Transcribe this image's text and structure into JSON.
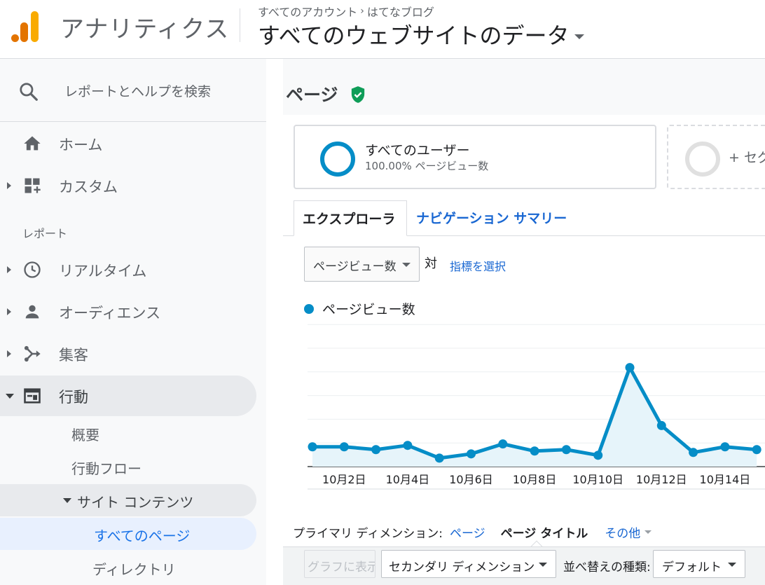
{
  "header": {
    "app_name": "アナリティクス",
    "breadcrumb_account": "すべてのアカウント",
    "breadcrumb_separator": "›",
    "breadcrumb_property": "はてなブログ",
    "view_name": "すべてのウェブサイトのデータ",
    "logo_colors": [
      "#f9ab00",
      "#e37400"
    ]
  },
  "sidebar": {
    "search_placeholder": "レポートとヘルプを検索",
    "home": "ホーム",
    "custom": "カスタム",
    "reports_label": "レポート",
    "items": [
      {
        "label": "リアルタイム",
        "icon": "clock-icon"
      },
      {
        "label": "オーディエンス",
        "icon": "person-icon"
      },
      {
        "label": "集客",
        "icon": "acquisition-icon"
      },
      {
        "label": "行動",
        "icon": "behavior-icon",
        "expanded": true
      }
    ],
    "behavior_sub": {
      "overview": "概要",
      "flow": "行動フロー",
      "site_content": "サイト コンテンツ",
      "all_pages": "すべてのページ",
      "directory": "ディレクトリ"
    }
  },
  "main": {
    "page_title": "ページ",
    "segment": {
      "name": "すべてのユーザー",
      "detail": "100.00% ページビュー数",
      "add_label": "+ セグ"
    },
    "tabs": {
      "explorer": "エクスプローラ",
      "nav_summary": "ナビゲーション サマリー"
    },
    "metric": {
      "selected": "ページビュー数",
      "vs": "対",
      "select_link": "指標を選択"
    },
    "legend_label": "ページビュー数",
    "dimensions": {
      "label": "プライマリ ディメンション:",
      "page": "ページ",
      "page_title": "ページ タイトル",
      "other": "その他"
    },
    "toolbar": {
      "plot_rows": "グラフに表示",
      "secondary_dimension": "セカンダリ ディメンション",
      "sort_label": "並べ替えの種類:",
      "sort_value": "デフォルト"
    }
  },
  "chart_data": {
    "type": "area",
    "categories": [
      "10月1日",
      "10月2日",
      "10月3日",
      "10月4日",
      "10月5日",
      "10月6日",
      "10月7日",
      "10月8日",
      "10月9日",
      "10月10日",
      "10月11日",
      "10月12日",
      "10月13日",
      "10月14日",
      "10月15日"
    ],
    "tick_labels": [
      "10月2日",
      "10月4日",
      "10月6日",
      "10月8日",
      "10月10日",
      "10月12日",
      "10月14日"
    ],
    "series": [
      {
        "values": [
          14,
          14,
          12,
          15,
          6,
          9,
          16,
          11,
          12,
          8,
          70,
          29,
          10,
          14,
          12
        ],
        "color": "#058dc7"
      }
    ],
    "ylim": [
      0,
      100
    ],
    "grid": true,
    "legend": "top-left"
  }
}
